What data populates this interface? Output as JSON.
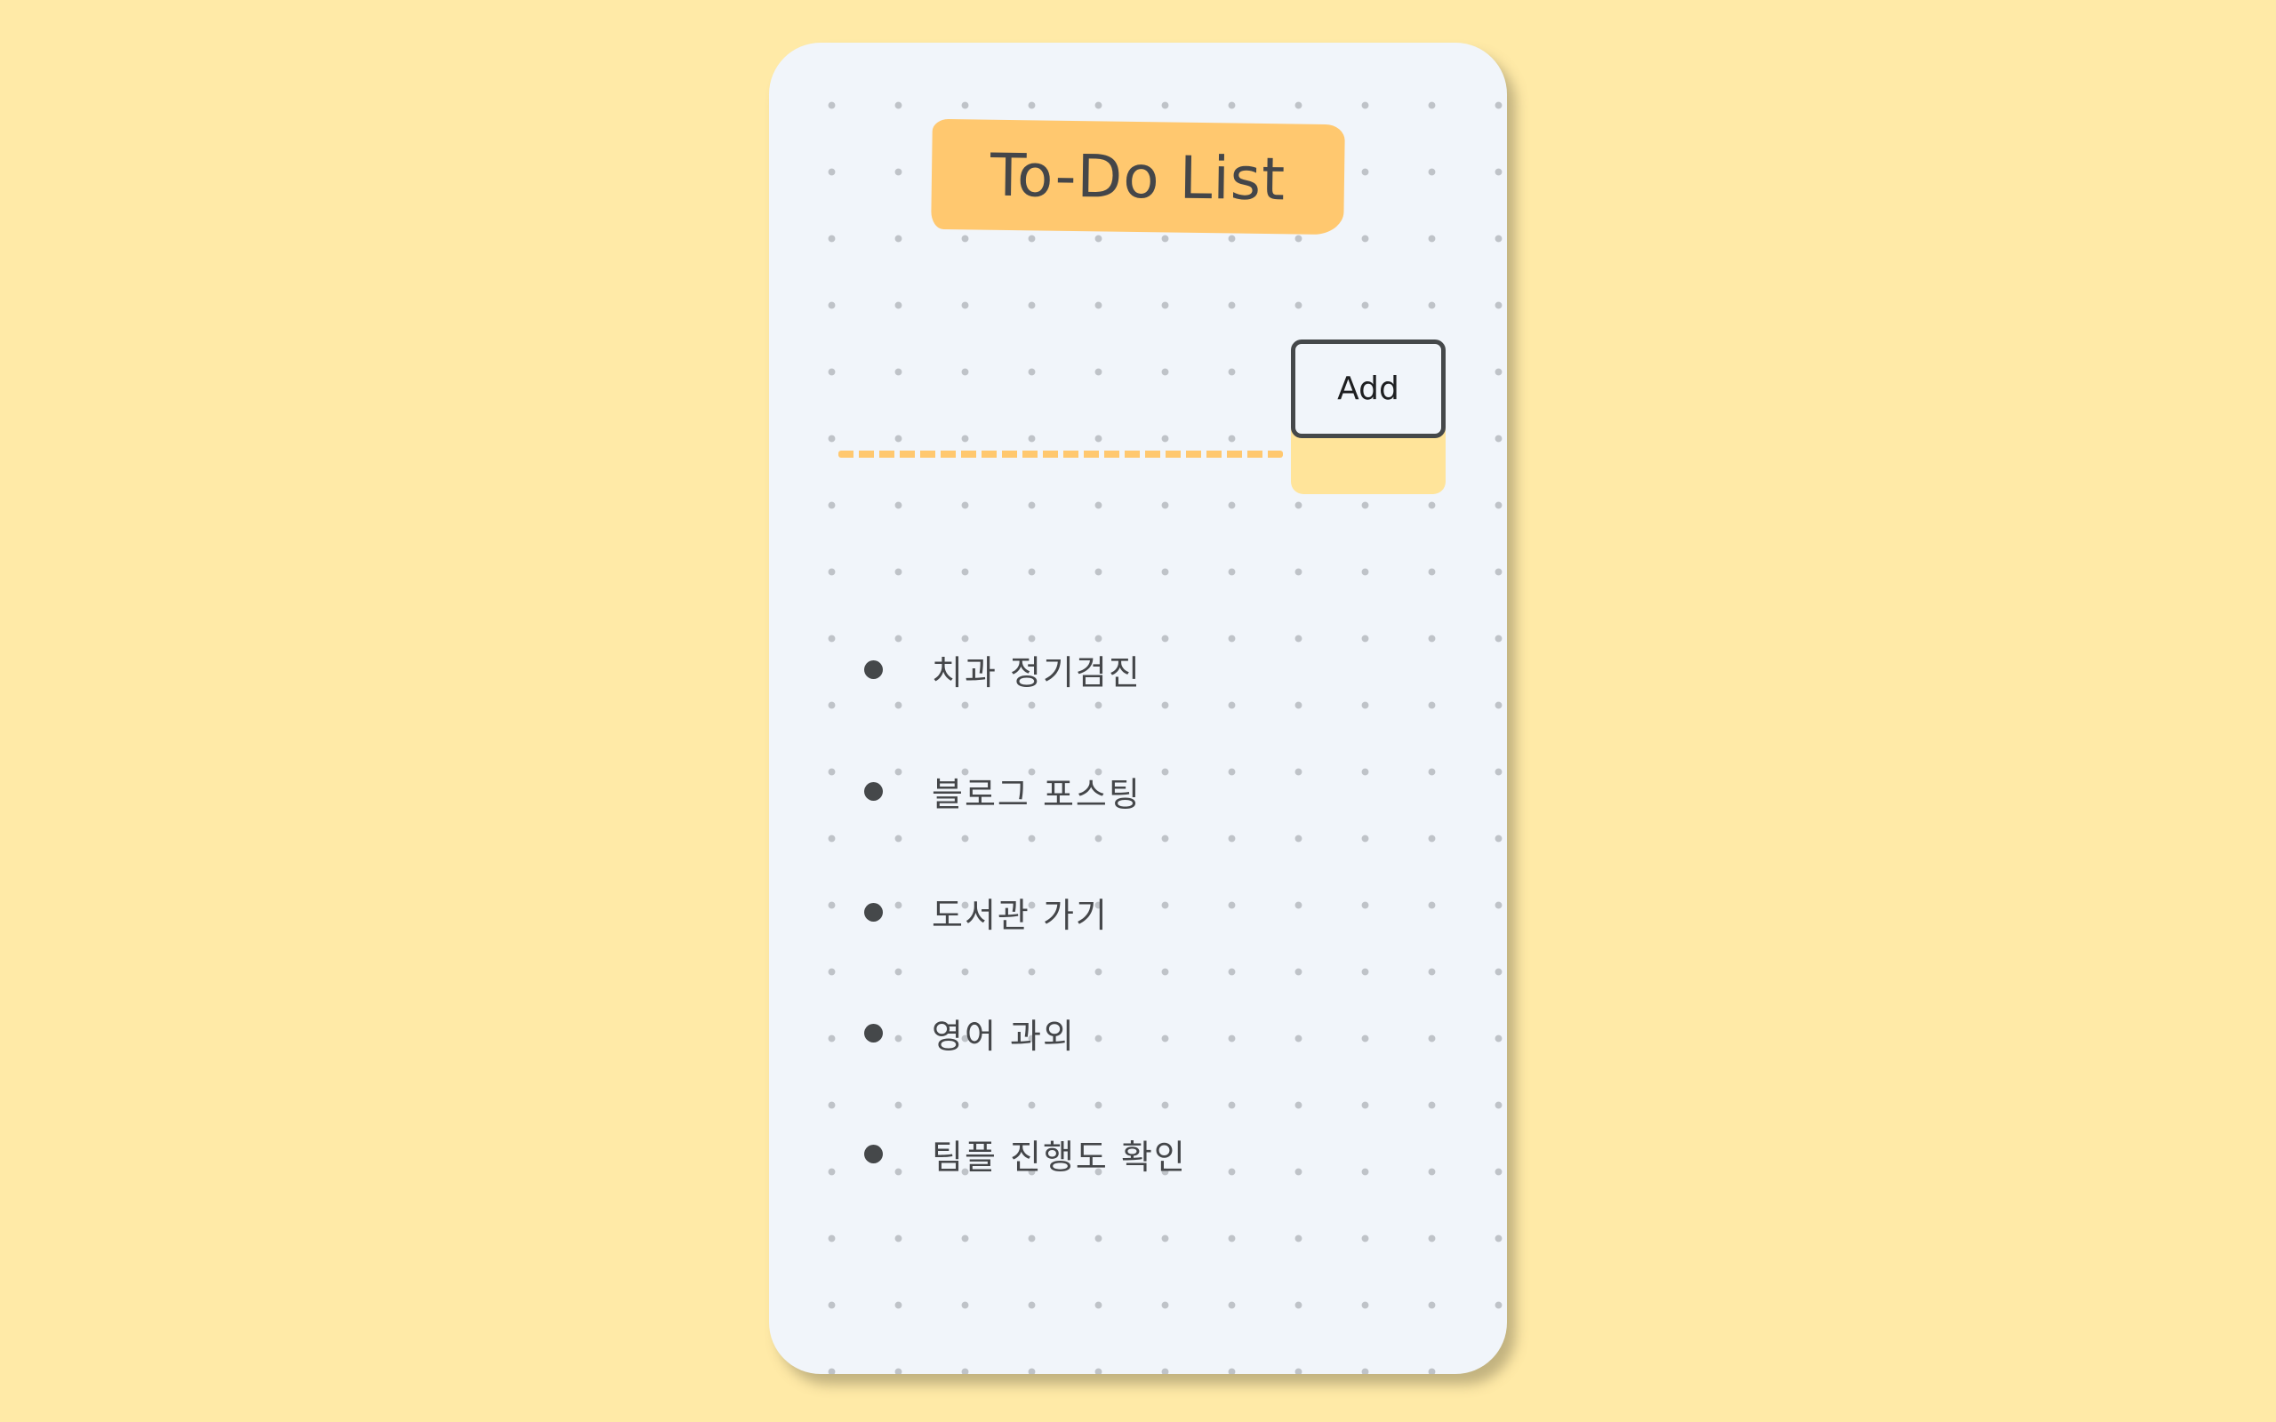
{
  "app": {
    "title": "To-Do List"
  },
  "form": {
    "input_value": "",
    "input_placeholder": "",
    "add_label": "Add"
  },
  "todos": [
    {
      "text": "치과 정기검진"
    },
    {
      "text": "블로그 포스팅"
    },
    {
      "text": "도서관 가기"
    },
    {
      "text": "영어 과외"
    },
    {
      "text": "팀플 진행도 확인"
    }
  ],
  "colors": {
    "background": "#FFEAA7",
    "card": "#F1F5FA",
    "accent": "#FFC86F",
    "ink": "#45484A",
    "dot": "#BFC3C8"
  }
}
